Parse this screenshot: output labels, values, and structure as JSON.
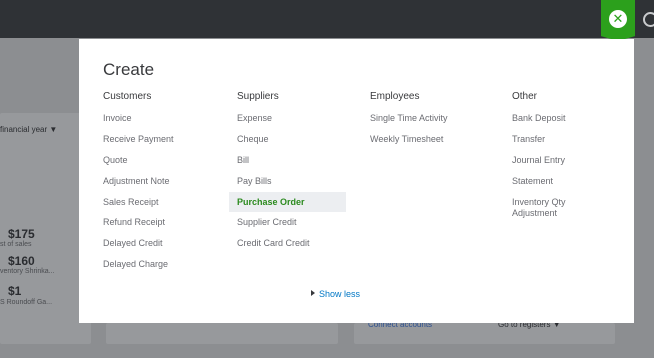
{
  "modal": {
    "title": "Create",
    "columns": [
      {
        "heading": "Customers",
        "items": [
          "Invoice",
          "Receive Payment",
          "Quote",
          "Adjustment Note",
          "Sales Receipt",
          "Refund Receipt",
          "Delayed Credit",
          "Delayed Charge"
        ]
      },
      {
        "heading": "Suppliers",
        "items": [
          "Expense",
          "Cheque",
          "Bill",
          "Pay Bills",
          "Purchase Order",
          "Supplier Credit",
          "Credit Card Credit"
        ]
      },
      {
        "heading": "Employees",
        "items": [
          "Single Time Activity",
          "Weekly Timesheet"
        ]
      },
      {
        "heading": "Other",
        "items": [
          "Bank Deposit",
          "Transfer",
          "Journal Entry",
          "Statement",
          "Inventory Qty Adjustment"
        ]
      }
    ],
    "active_item": "Purchase Order",
    "show_less_label": "Show less"
  },
  "background": {
    "financial_year_dropdown": "financial year ▼",
    "stats": [
      {
        "amount": "$175",
        "label": "st of sales"
      },
      {
        "amount": "$160",
        "label": "ventory Shrinka..."
      },
      {
        "amount": "$1",
        "label": "S Roundoff Ga..."
      }
    ],
    "connect_accounts": "Connect accounts",
    "go_to_registers": "Go to registers ▼"
  },
  "icons": {
    "close": "close-icon",
    "search": "search-icon",
    "show_less_caret": "caret-right-icon"
  },
  "colors": {
    "topbar": "#2f3236",
    "accent_green": "#2ca01c",
    "active_item": "#2b8a1e",
    "link_blue": "#0077c5"
  }
}
